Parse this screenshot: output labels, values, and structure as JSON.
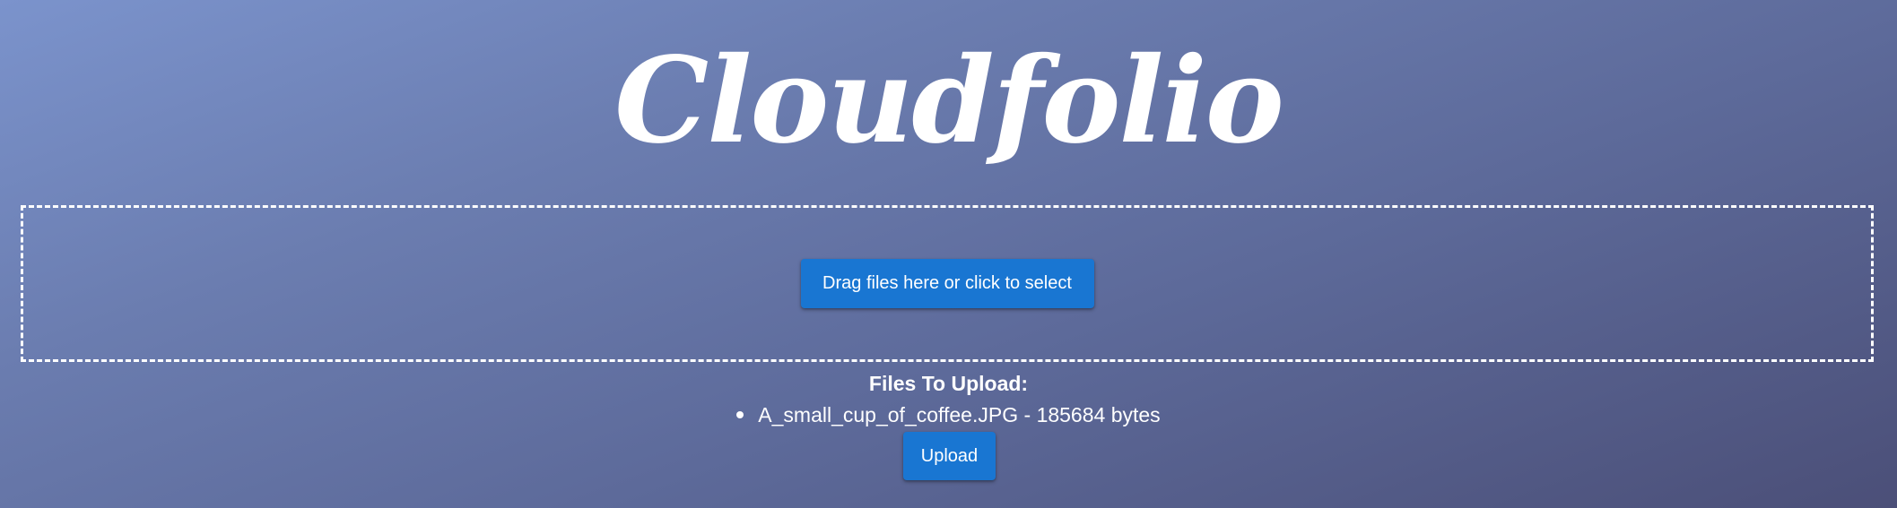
{
  "app": {
    "logo_text": "Cloudfolio"
  },
  "dropzone": {
    "button_label": "Drag files here or click to select"
  },
  "files": {
    "title": "Files To Upload:",
    "items": [
      {
        "name": "A_small_cup_of_coffee.JPG",
        "separator": " - ",
        "size": "185684 bytes"
      }
    ]
  },
  "actions": {
    "upload_label": "Upload"
  },
  "colors": {
    "accent": "#1976d2",
    "background_start": "#7b93cc",
    "background_end": "#4b4f78"
  }
}
